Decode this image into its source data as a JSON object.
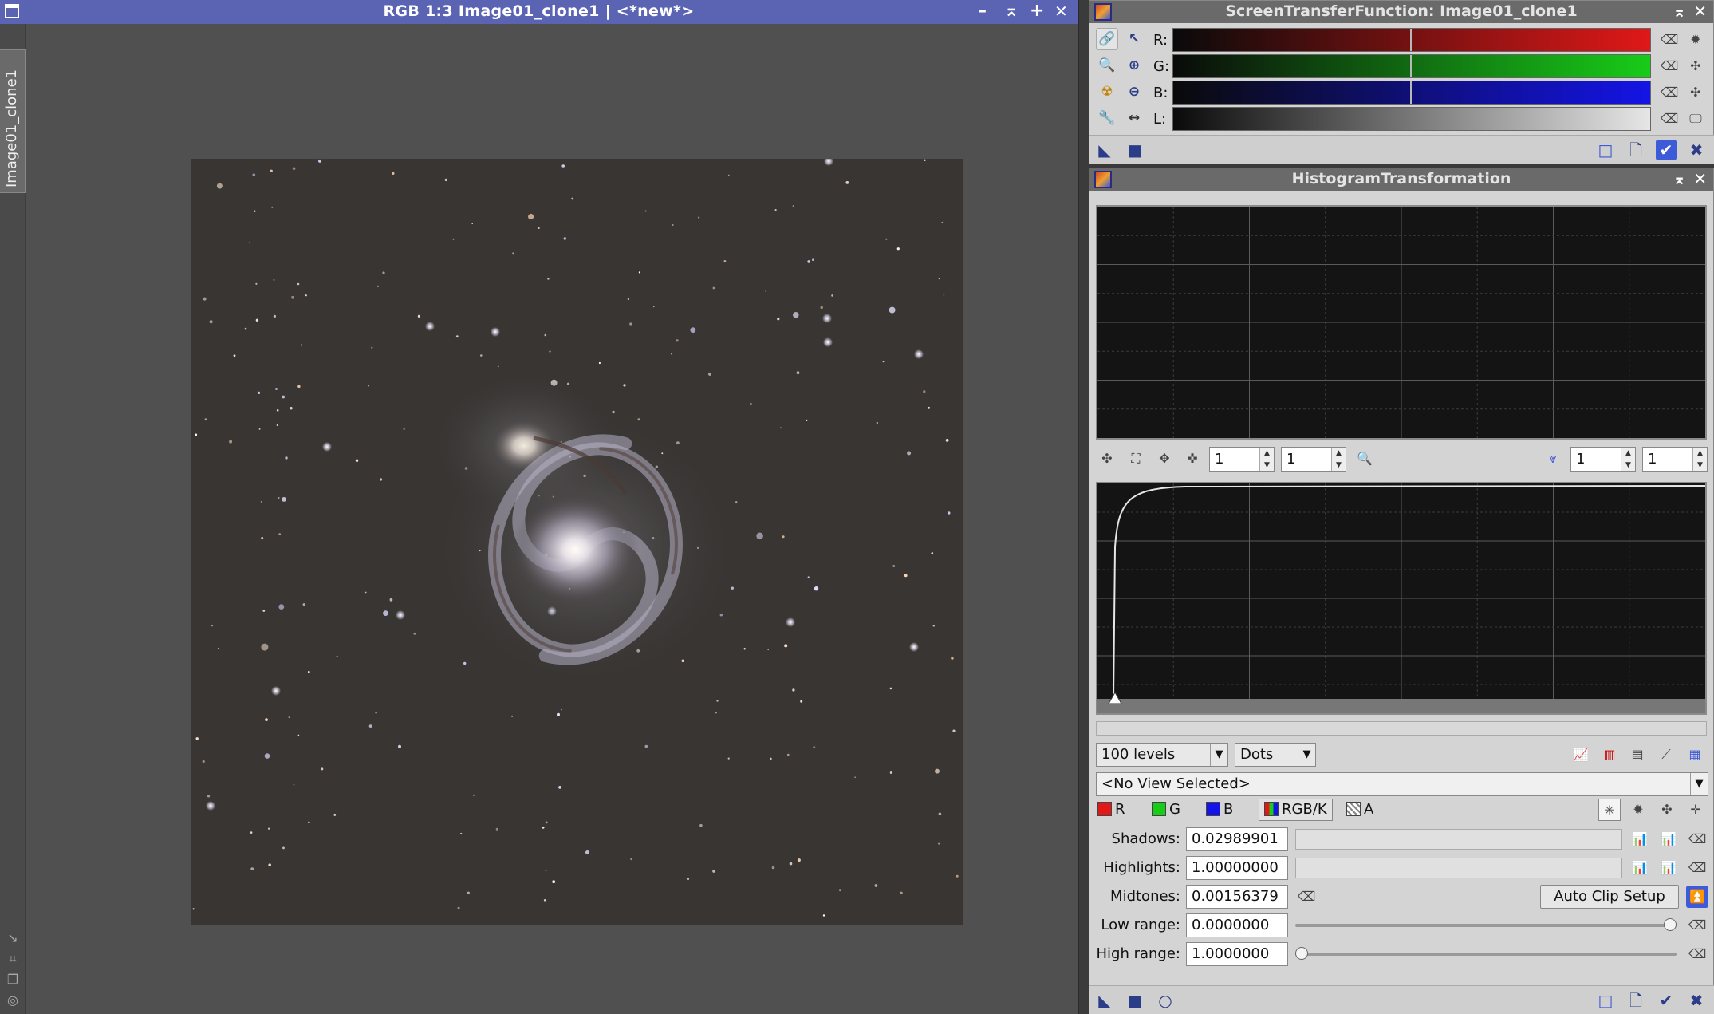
{
  "image_window": {
    "title": "RGB 1:3 Image01_clone1 | <*new*>",
    "side_tab": "Image01_clone1",
    "controls": {
      "minimize": "–",
      "shade": "⌅",
      "maximize": "+",
      "close": "✕"
    }
  },
  "stf": {
    "title": "ScreenTransferFunction: Image01_clone1",
    "channels": [
      {
        "label": "R:",
        "color": "#e01818"
      },
      {
        "label": "G:",
        "color": "#18cc18"
      },
      {
        "label": "B:",
        "color": "#1414e6"
      },
      {
        "label": "L:",
        "color": "#e6e6e6"
      }
    ]
  },
  "ht": {
    "title": "HistogramTransformation",
    "zoom": {
      "h": "1",
      "v": "1"
    },
    "output_zoom": {
      "h": "1",
      "v": "1"
    },
    "levels": "100 levels",
    "graph_style": "Dots",
    "view": "<No View Selected>",
    "channels": {
      "r": "R",
      "g": "G",
      "b": "B",
      "rgbk": "RGB/K",
      "a": "A"
    },
    "shadows": {
      "label": "Shadows:",
      "value": "0.02989901"
    },
    "highlights": {
      "label": "Highlights:",
      "value": "1.00000000"
    },
    "midtones": {
      "label": "Midtones:",
      "value": "0.00156379"
    },
    "low_range": {
      "label": "Low range:",
      "value": "0.0000000"
    },
    "high_range": {
      "label": "High range:",
      "value": "1.0000000"
    },
    "auto_clip": "Auto Clip Setup"
  }
}
